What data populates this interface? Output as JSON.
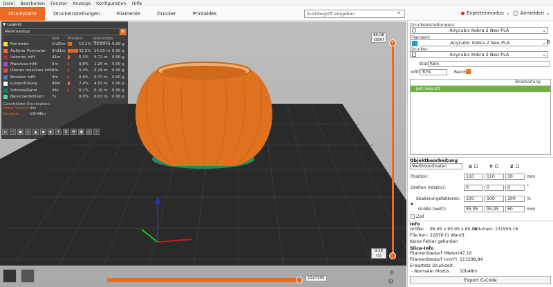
{
  "menu": [
    "Datei",
    "Bearbeiten",
    "Fenster",
    "Anzeige",
    "Konfiguration",
    "Hilfe"
  ],
  "tabs": [
    "Druckplatte",
    "Druckeinstellungen",
    "Filamente",
    "Drucker",
    "Printables"
  ],
  "search": {
    "placeholder": "Suchbegriff eingeben"
  },
  "mode": "Expertenmodus",
  "login": "Anmelden",
  "legend": {
    "title": "Legend",
    "selector": "Merkmalstyp",
    "cols": {
      "time": "Zeit",
      "pct": "Prozent",
      "fil": "Genutztes Filament"
    },
    "rows": [
      {
        "name": "Perimeter",
        "time": "1h25m",
        "pct": "13,1%",
        "len": "11.24 m",
        "w": "0.00 g",
        "color": "#ffe24a",
        "bar": 13.1
      },
      {
        "name": "Äußerer Perimeter",
        "time": "3h31m",
        "pct": "32,5%",
        "len": "24.25 m",
        "w": "0.00 g",
        "color": "#ed6b21",
        "bar": 32.5
      },
      {
        "name": "Internes Infill",
        "time": "41m",
        "pct": "6,3%",
        "len": "4.72 m",
        "w": "0.00 g",
        "color": "#b43232",
        "bar": 6.3
      },
      {
        "name": "Massives Infill",
        "time": "5m",
        "pct": "0,8%",
        "len": "1.20 m",
        "w": "0.00 g",
        "color": "#9654cc",
        "bar": 0.8
      },
      {
        "name": "Oberes massives Infill",
        "time": "2m",
        "pct": "0,4%",
        "len": "0.29 m",
        "w": "0.00 g",
        "color": "#f04040",
        "bar": 0.4
      },
      {
        "name": "Brücken Infill",
        "time": "4m",
        "pct": "0,6%",
        "len": "0.37 m",
        "w": "0.00 g",
        "color": "#4d80ba",
        "bar": 0.6
      },
      {
        "name": "Lückenfüllung",
        "time": "48m",
        "pct": "7,4%",
        "len": "4.92 m",
        "w": "0.00 g",
        "color": "#ffffff",
        "bar": 7.4
      },
      {
        "name": "Schürze/Rand",
        "time": "34s",
        "pct": "0,1%",
        "len": "0.10 m",
        "w": "0.00 g",
        "color": "#00876e",
        "bar": 0.1
      },
      {
        "name": "Benutzerdefiniert",
        "time": "7s",
        "pct": "0,0%",
        "len": "0.03 m",
        "w": "0.00 g",
        "color": "#5ed194",
        "bar": 0.0
      }
    ],
    "est_title": "Geschätzte Druckzeiten:",
    "first_layer_label": "Erste Schicht:",
    "first_layer": "3m",
    "total_label": "Gesamt:",
    "total": "10h48m"
  },
  "vslider": {
    "top": "60.08",
    "top_layer": "(300)",
    "bottom": "0.28",
    "bottom_layer": "(1)"
  },
  "hslider": {
    "value": "1527395",
    "progress": 0.98
  },
  "right": {
    "print_settings_label": "Druckeinstellungen:",
    "print_settings": "Anycubic Kobra 2 Neo-PLA",
    "filament_label": "Filament:",
    "filament": "Anycubic Kobra 2 Neo-PLA",
    "printer_label": "Drucker:",
    "printer": "Anycubic Kobra 2 Neo-PLA",
    "supports_label": "Stützen:",
    "supports": "Kein",
    "infill_label": "Infill:",
    "infill": "30%",
    "brim_label": "Rand:",
    "objcol_edit": "Bearbeitung",
    "object": "pot_ikea.stl",
    "objedit_title": "Objektbearbeitung",
    "coords": "Weltkoordinaten",
    "ax": [
      "X",
      "Y",
      "Z"
    ],
    "pos_label": "Position:",
    "pos": [
      "110",
      "110",
      "30"
    ],
    "pos_unit": "mm",
    "rot_label": "Drehen (relativ):",
    "rot": [
      "0",
      "0",
      "0"
    ],
    "rot_unit": "°",
    "scale_label": "Skalierungsfaktoren:",
    "scale": [
      "100",
      "100",
      "100"
    ],
    "scale_unit": "%",
    "size_label": "Größe [welt]:",
    "size": [
      "95,95",
      "95,95",
      "60"
    ],
    "size_unit": "mm",
    "inch": "Zoll",
    "info_title": "Info",
    "info_size_label": "Größe:",
    "info_size": "95,95 x 95,95 x 60,00",
    "info_vol_label": "Volumen:",
    "info_vol": "131955,16",
    "info_faces_label": "Flächen:",
    "info_faces": "22876 (1 Wand)",
    "info_errors": "Keine Fehler gefunden",
    "slice_title": "Slice-Info",
    "fil_m_label": "Filamentbedarf (Meter)",
    "fil_m": "47,10",
    "fil_mm3_label": "Filamentbedarf (mm³)",
    "fil_mm3": "113298,84",
    "est_label": "Erwartete Druckzeit:",
    "normal_label": "- Normaler Modus",
    "normal": "10h48m",
    "export": "Export G-Code"
  }
}
